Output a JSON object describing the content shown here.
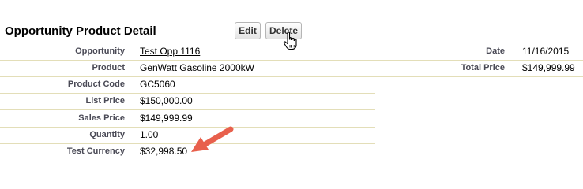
{
  "header": {
    "title": "Opportunity Product Detail",
    "edit_label": "Edit",
    "delete_label": "Delete"
  },
  "fields_left": [
    {
      "label": "Opportunity",
      "value": "Test Opp 1116",
      "link": true
    },
    {
      "label": "Product",
      "value": "GenWatt Gasoline 2000kW",
      "link": true
    },
    {
      "label": "Product Code",
      "value": "GC5060",
      "link": false
    },
    {
      "label": "List Price",
      "value": "$150,000.00",
      "link": false
    },
    {
      "label": "Sales Price",
      "value": "$149,999.99",
      "link": false
    },
    {
      "label": "Quantity",
      "value": "1.00",
      "link": false
    },
    {
      "label": "Test Currency",
      "value": "$32,998.50",
      "link": false
    }
  ],
  "fields_right": [
    {
      "label": "Date",
      "value": "11/16/2015"
    },
    {
      "label": "Total Price",
      "value": "$149,999.99"
    }
  ],
  "icons": {
    "cursor": "hand-pointer-icon",
    "arrow": "annotation-arrow-icon"
  },
  "colors": {
    "arrow": "#e8604c",
    "divider": "#e3deb8",
    "label": "#4a4a56"
  }
}
